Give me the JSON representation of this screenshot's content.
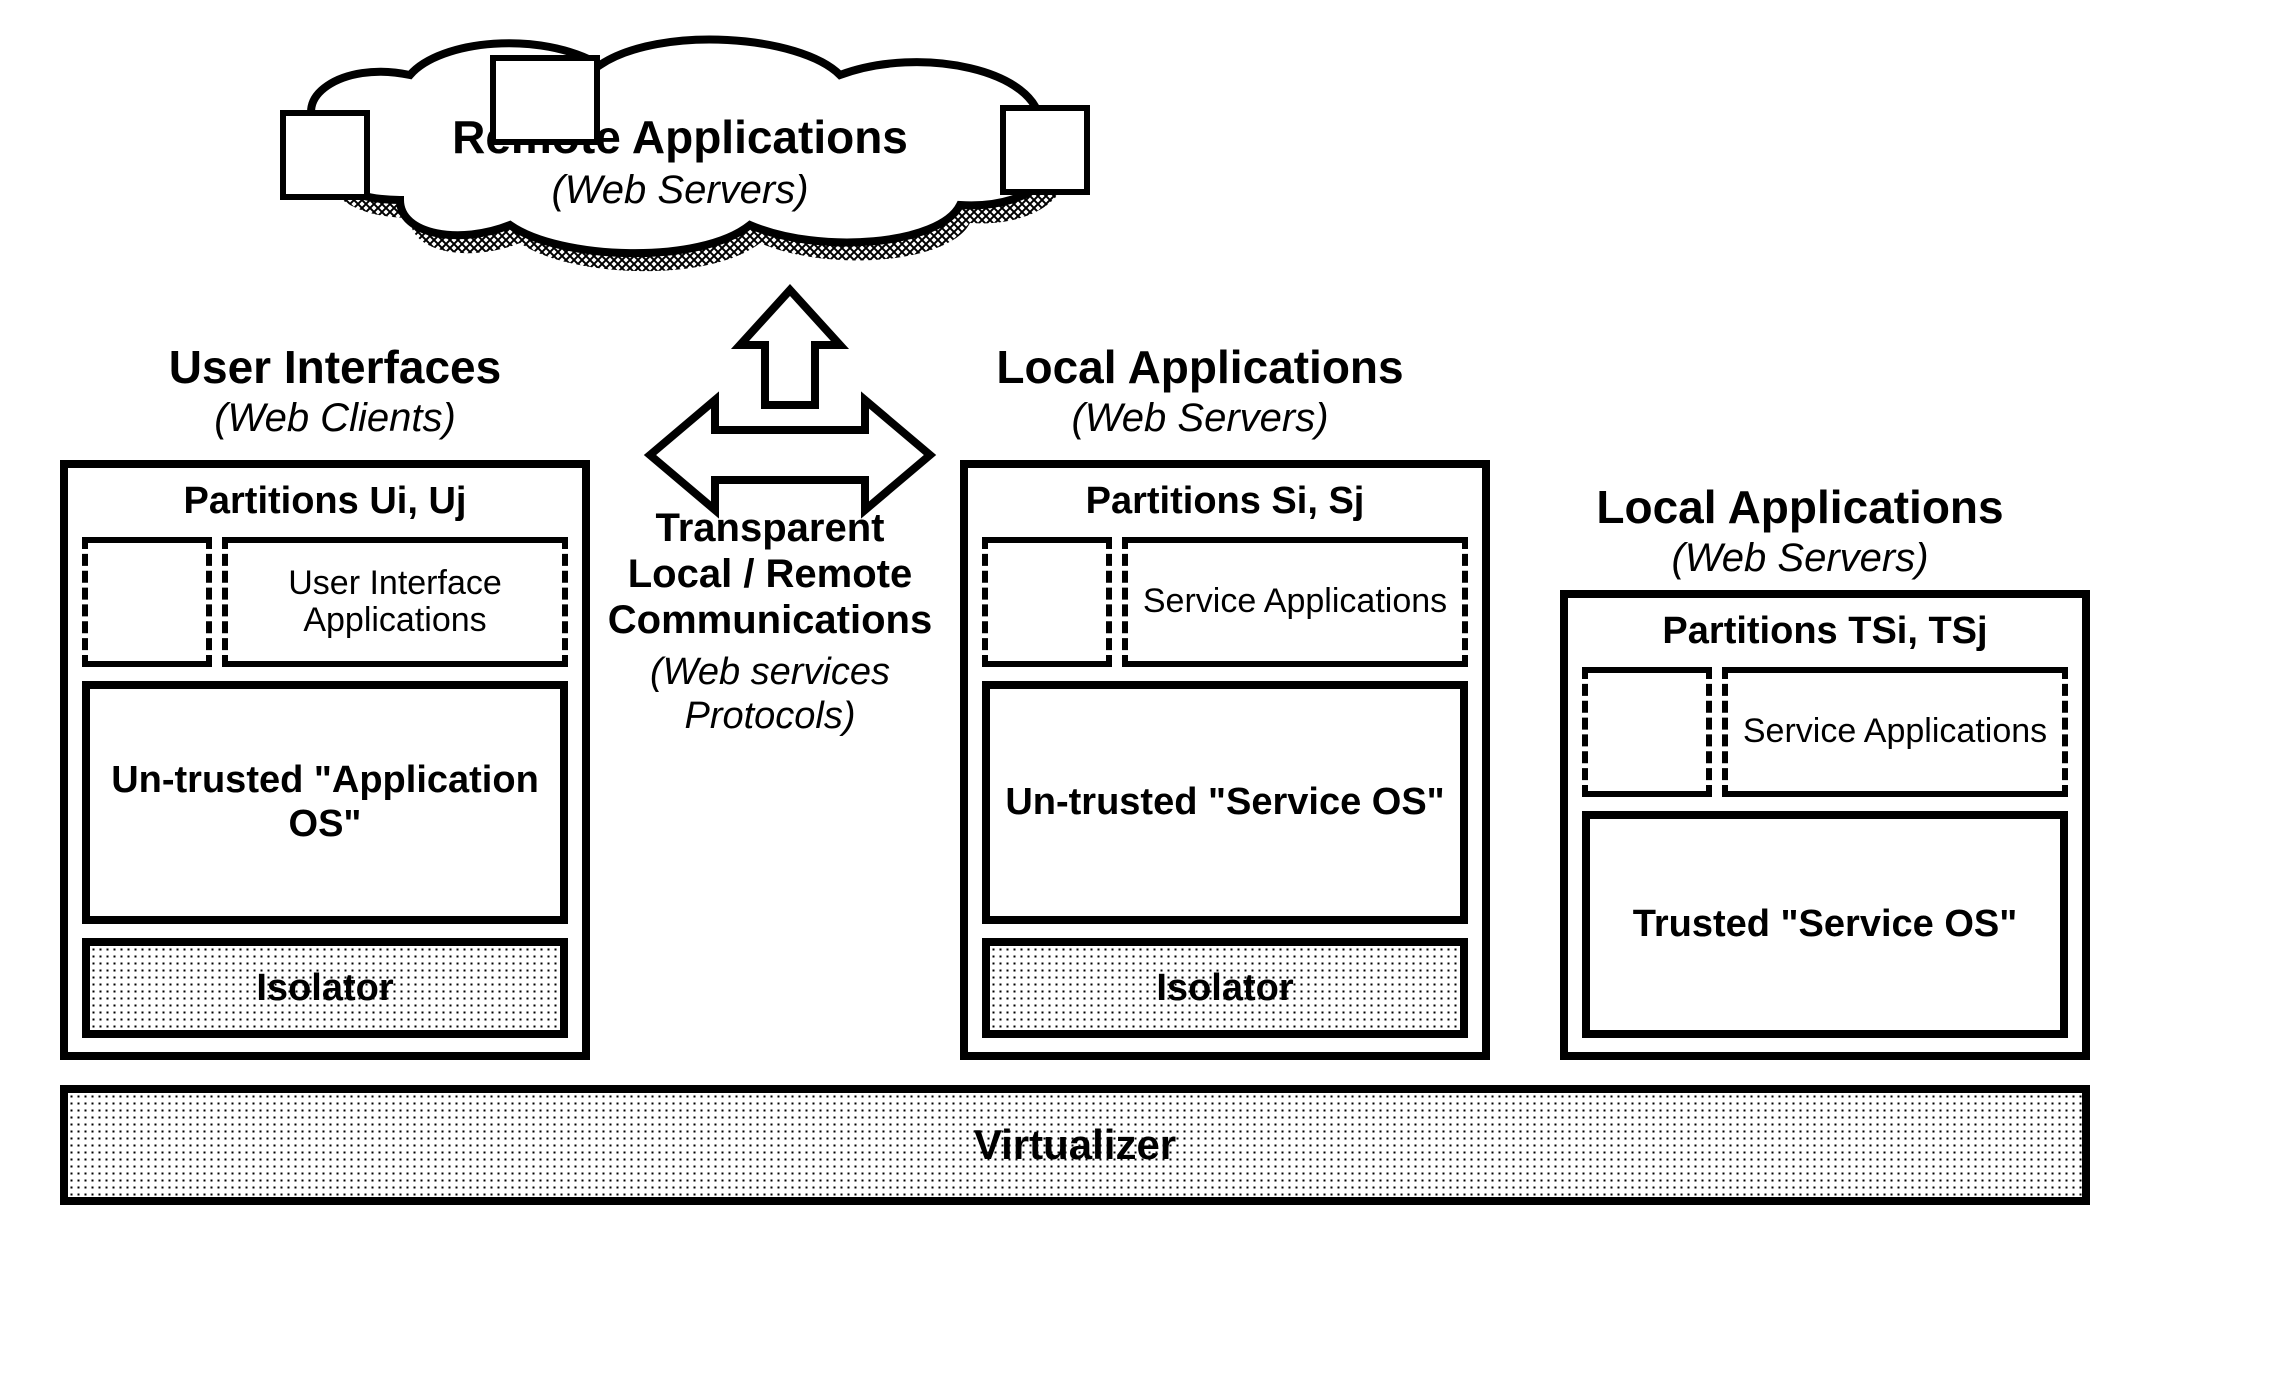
{
  "cloud": {
    "title": "Remote Applications",
    "subtitle": "(Web Servers)"
  },
  "headings": {
    "ui": {
      "title": "User Interfaces",
      "subtitle": "(Web Clients)"
    },
    "la1": {
      "title": "Local Applications",
      "subtitle": "(Web Servers)"
    },
    "la2": {
      "title": "Local Applications",
      "subtitle": "(Web Servers)"
    }
  },
  "center": {
    "line1": "Transparent",
    "line2": "Local / Remote",
    "line3": "Communications",
    "sub1": "(Web services",
    "sub2": "Protocols)"
  },
  "partitions": {
    "p1": {
      "title": "Partitions Ui, Uj",
      "apps": "User Interface Applications",
      "os": "Un-trusted \"Application OS\"",
      "isolator": "Isolator"
    },
    "p2": {
      "title": "Partitions Si, Sj",
      "apps": "Service Applications",
      "os": "Un-trusted \"Service OS\"",
      "isolator": "Isolator"
    },
    "p3": {
      "title": "Partitions TSi, TSj",
      "apps": "Service Applications",
      "os": "Trusted \"Service OS\""
    }
  },
  "virtualizer": "Virtualizer"
}
